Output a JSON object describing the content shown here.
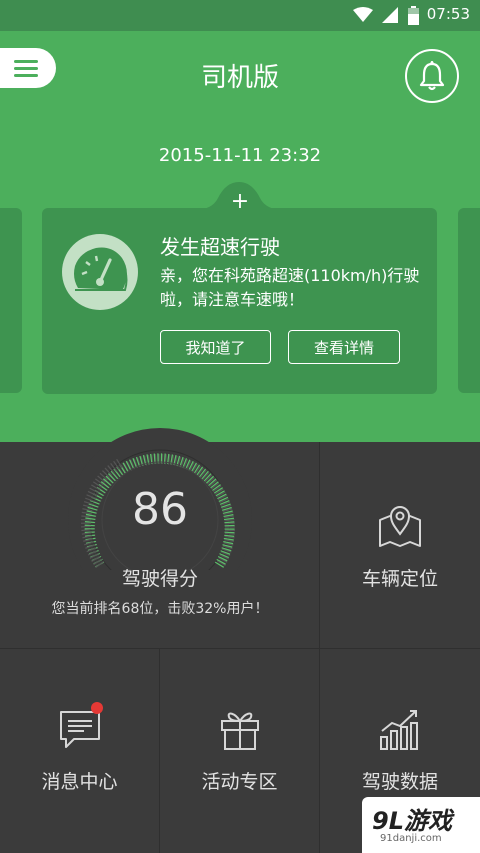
{
  "status_bar": {
    "time": "07:53",
    "icons": [
      "wifi-icon",
      "signal-icon",
      "battery-icon"
    ]
  },
  "header": {
    "title": "司机版",
    "menu_icon": "menu-icon",
    "bell_icon": "bell-icon"
  },
  "notice": {
    "datetime": "2015-11-11 23:32",
    "plus": "+",
    "icon": "speedometer-icon",
    "title": "发生超速行驶",
    "message": "亲，您在科苑路超速(110km/h)行驶啦，请注意车速哦！",
    "confirm_label": "我知道了",
    "details_label": "查看详情"
  },
  "score": {
    "value": "86",
    "label": "驾驶得分",
    "rank_text": "您当前排名68位，击败32%用户！"
  },
  "tiles": {
    "vehicle_location": {
      "label": "车辆定位",
      "icon": "map-pin-icon"
    },
    "messages": {
      "label": "消息中心",
      "icon": "message-icon",
      "has_badge": true
    },
    "promotions": {
      "label": "活动专区",
      "icon": "gift-icon"
    },
    "driving_data": {
      "label": "驾驶数据",
      "icon": "bar-chart-icon"
    }
  },
  "watermark": {
    "brand": "9L游戏",
    "url": "91danji.com"
  },
  "colors": {
    "green": "#4caf5c",
    "dark_green": "#3e9450",
    "dark_bg": "#3b3b3b",
    "badge": "#e53935"
  }
}
